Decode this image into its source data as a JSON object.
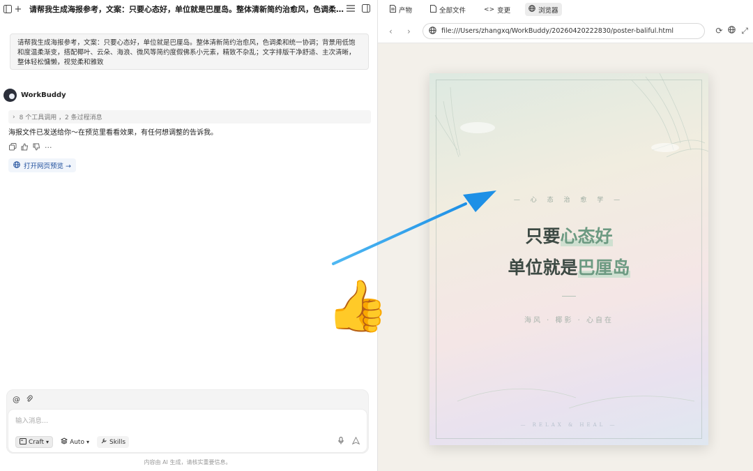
{
  "chat": {
    "title": "请帮我生成海报参考，文案：只要心态好，单位就是巴厘岛。整体清新简约治愈风，色调柔和统一协调；背景用低饱和度温柔渐变，搭配椰叶、云朵、海浪、微风等简约度假佛系小元素，精致不杂乱；文字排版干净舒适、主次清晰，整体轻松慵懒，视觉柔和雅致",
    "user_message": "请帮我生成海报参考，文案：只要心态好，单位就是巴厘岛。整体清新简约治愈风，色调柔和统一协调；背景用低饱和度温柔渐变，搭配椰叶、云朵、海浪、微风等简约度假佛系小元素，精致不杂乱；文字排版干净舒适、主次清晰，整体轻松慵懒，视觉柔和雅致",
    "assistant_name": "WorkBuddy",
    "tool_summary": "8 个工具调用 ，2 条过程消息",
    "reply": "海报文件已发送给你～在预览里看看效果，有任何想调整的告诉我。",
    "preview_button": "打开网页预览 →",
    "composer": {
      "placeholder": "输入消息...",
      "mode_label": "Craft",
      "auto_label": "Auto",
      "skills_label": "Skills"
    },
    "disclaimer": "内容由 AI 生成，请核实重要信息。"
  },
  "browser": {
    "tabs": [
      {
        "label": "产物",
        "icon": "document-icon"
      },
      {
        "label": "全部文件",
        "icon": "file-icon"
      },
      {
        "label": "变更",
        "icon": "code-icon"
      },
      {
        "label": "浏览器",
        "icon": "globe-icon",
        "active": true
      }
    ],
    "url": "file:///Users/zhangxq/WorkBuddy/20260420222830/poster-baliful.html"
  },
  "poster": {
    "eyebrow": "— 心 态 治 愈 学 —",
    "line1_prefix": "只要",
    "line1_highlight": "心态好",
    "line2_prefix": "单位就是",
    "line2_highlight": "巴厘岛",
    "sub": "海风 · 椰影 · 心自在",
    "footer": "— RELAX & HEAL —"
  },
  "colors": {
    "arrow": "#2aa3ee",
    "highlight": "#6d9a82",
    "link": "#1e4e9c"
  }
}
